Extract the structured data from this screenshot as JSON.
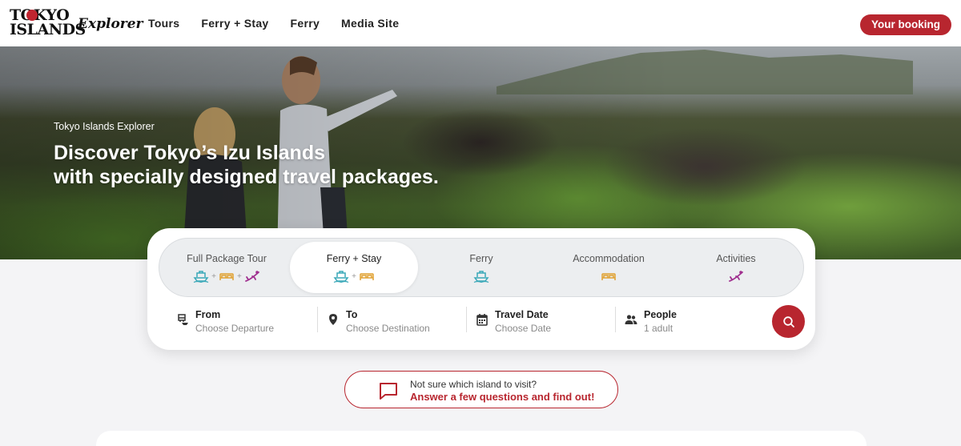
{
  "header": {
    "logo": {
      "line1": "TOKYO",
      "line2": "ISLANDS",
      "script": "Explorer"
    },
    "nav": [
      "Tours",
      "Ferry + Stay",
      "Ferry",
      "Media Site"
    ],
    "booking_label": "Your booking"
  },
  "hero": {
    "subtitle": "Tokyo Islands Explorer",
    "title_line1": "Discover Tokyo’s Izu Islands",
    "title_line2": "with specially designed travel packages."
  },
  "tabs": [
    {
      "label": "Full Package Tour",
      "icons": [
        "ferry-icon",
        "bed-icon",
        "activity-icon"
      ],
      "active": false
    },
    {
      "label": "Ferry + Stay",
      "icons": [
        "ferry-icon",
        "bed-icon"
      ],
      "active": true
    },
    {
      "label": "Ferry",
      "icons": [
        "ferry-icon"
      ],
      "active": false
    },
    {
      "label": "Accommodation",
      "icons": [
        "bed-icon"
      ],
      "active": false
    },
    {
      "label": "Activities",
      "icons": [
        "activity-icon"
      ],
      "active": false
    }
  ],
  "fields": {
    "from": {
      "label": "From",
      "value": "Choose Departure",
      "icon": "ferry-stop-icon"
    },
    "to": {
      "label": "To",
      "value": "Choose Destination",
      "icon": "map-pin-icon"
    },
    "date": {
      "label": "Travel Date",
      "value": "Choose Date",
      "icon": "calendar-icon"
    },
    "people": {
      "label": "People",
      "value": "1 adult",
      "icon": "people-icon"
    }
  },
  "quiz": {
    "question": "Not sure which island to visit?",
    "cta": "Answer a few questions and find out!"
  },
  "colors": {
    "brand_red": "#b8262f",
    "ferry_teal": "#3aa8b8",
    "bed_orange": "#e0a030",
    "activity_purple": "#a0308f"
  }
}
